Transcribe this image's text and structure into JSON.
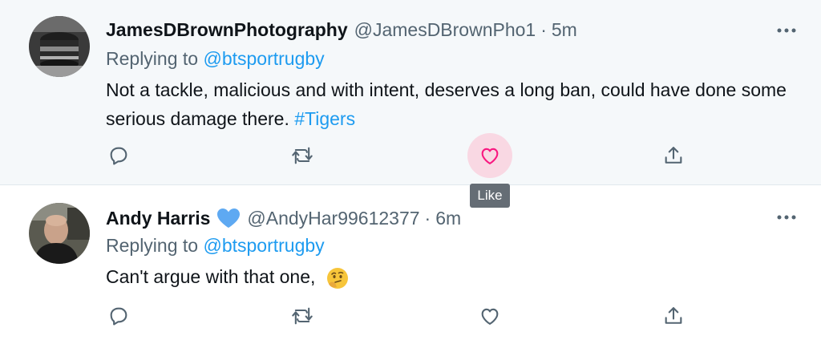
{
  "tweets": [
    {
      "author_name": "JamesDBrownPhotography",
      "handle": "@JamesDBrownPho1",
      "separator": "·",
      "time": "5m",
      "replying_prefix": "Replying to",
      "replying_to": "@btsportrugby",
      "text": "Not a tackle, malicious and with intent, deserves a long ban, could have done some serious damage there.",
      "hashtag": "#Tigers",
      "like_active": true
    },
    {
      "author_name": "Andy Harris",
      "verified_icon": "blue-heart-icon",
      "handle": "@AndyHar99612377",
      "separator": "·",
      "time": "6m",
      "replying_prefix": "Replying to",
      "replying_to": "@btsportrugby",
      "text": "Can't argue with that one,",
      "emoji": "thinking-face-icon",
      "like_active": false
    }
  ],
  "tooltip": {
    "label": "Like"
  },
  "colors": {
    "link": "#1d9bf0",
    "secondary_text": "#536471",
    "icon": "#536471",
    "like_active": "#f91880",
    "like_hover_bg": "#f9d8e3",
    "tooltip_bg": "#656d75",
    "hovered_row_bg": "#f5f8fa"
  },
  "icons": [
    "reply-icon",
    "retweet-icon",
    "like-icon",
    "share-icon",
    "more-options-icon"
  ]
}
